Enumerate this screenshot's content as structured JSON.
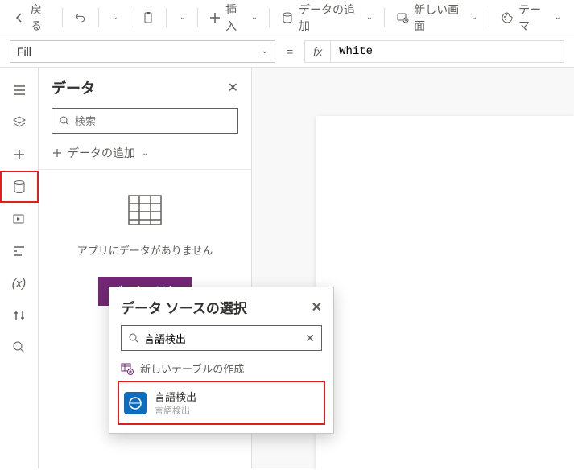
{
  "toolbar": {
    "back": "戻る",
    "insert": "挿入",
    "add_data": "データの追加",
    "new_screen": "新しい画面",
    "theme": "テーマ"
  },
  "formula": {
    "property": "Fill",
    "fx": "fx",
    "value": "White"
  },
  "panel": {
    "title": "データ",
    "search_placeholder": "検索",
    "add_data": "データの追加",
    "empty_message": "アプリにデータがありません",
    "add_button": "データの追加"
  },
  "popup": {
    "title": "データ ソースの選択",
    "search_value": "言語検出",
    "new_table": "新しいテーブルの作成",
    "result": {
      "title": "言語検出",
      "subtitle": "言語検出"
    }
  }
}
